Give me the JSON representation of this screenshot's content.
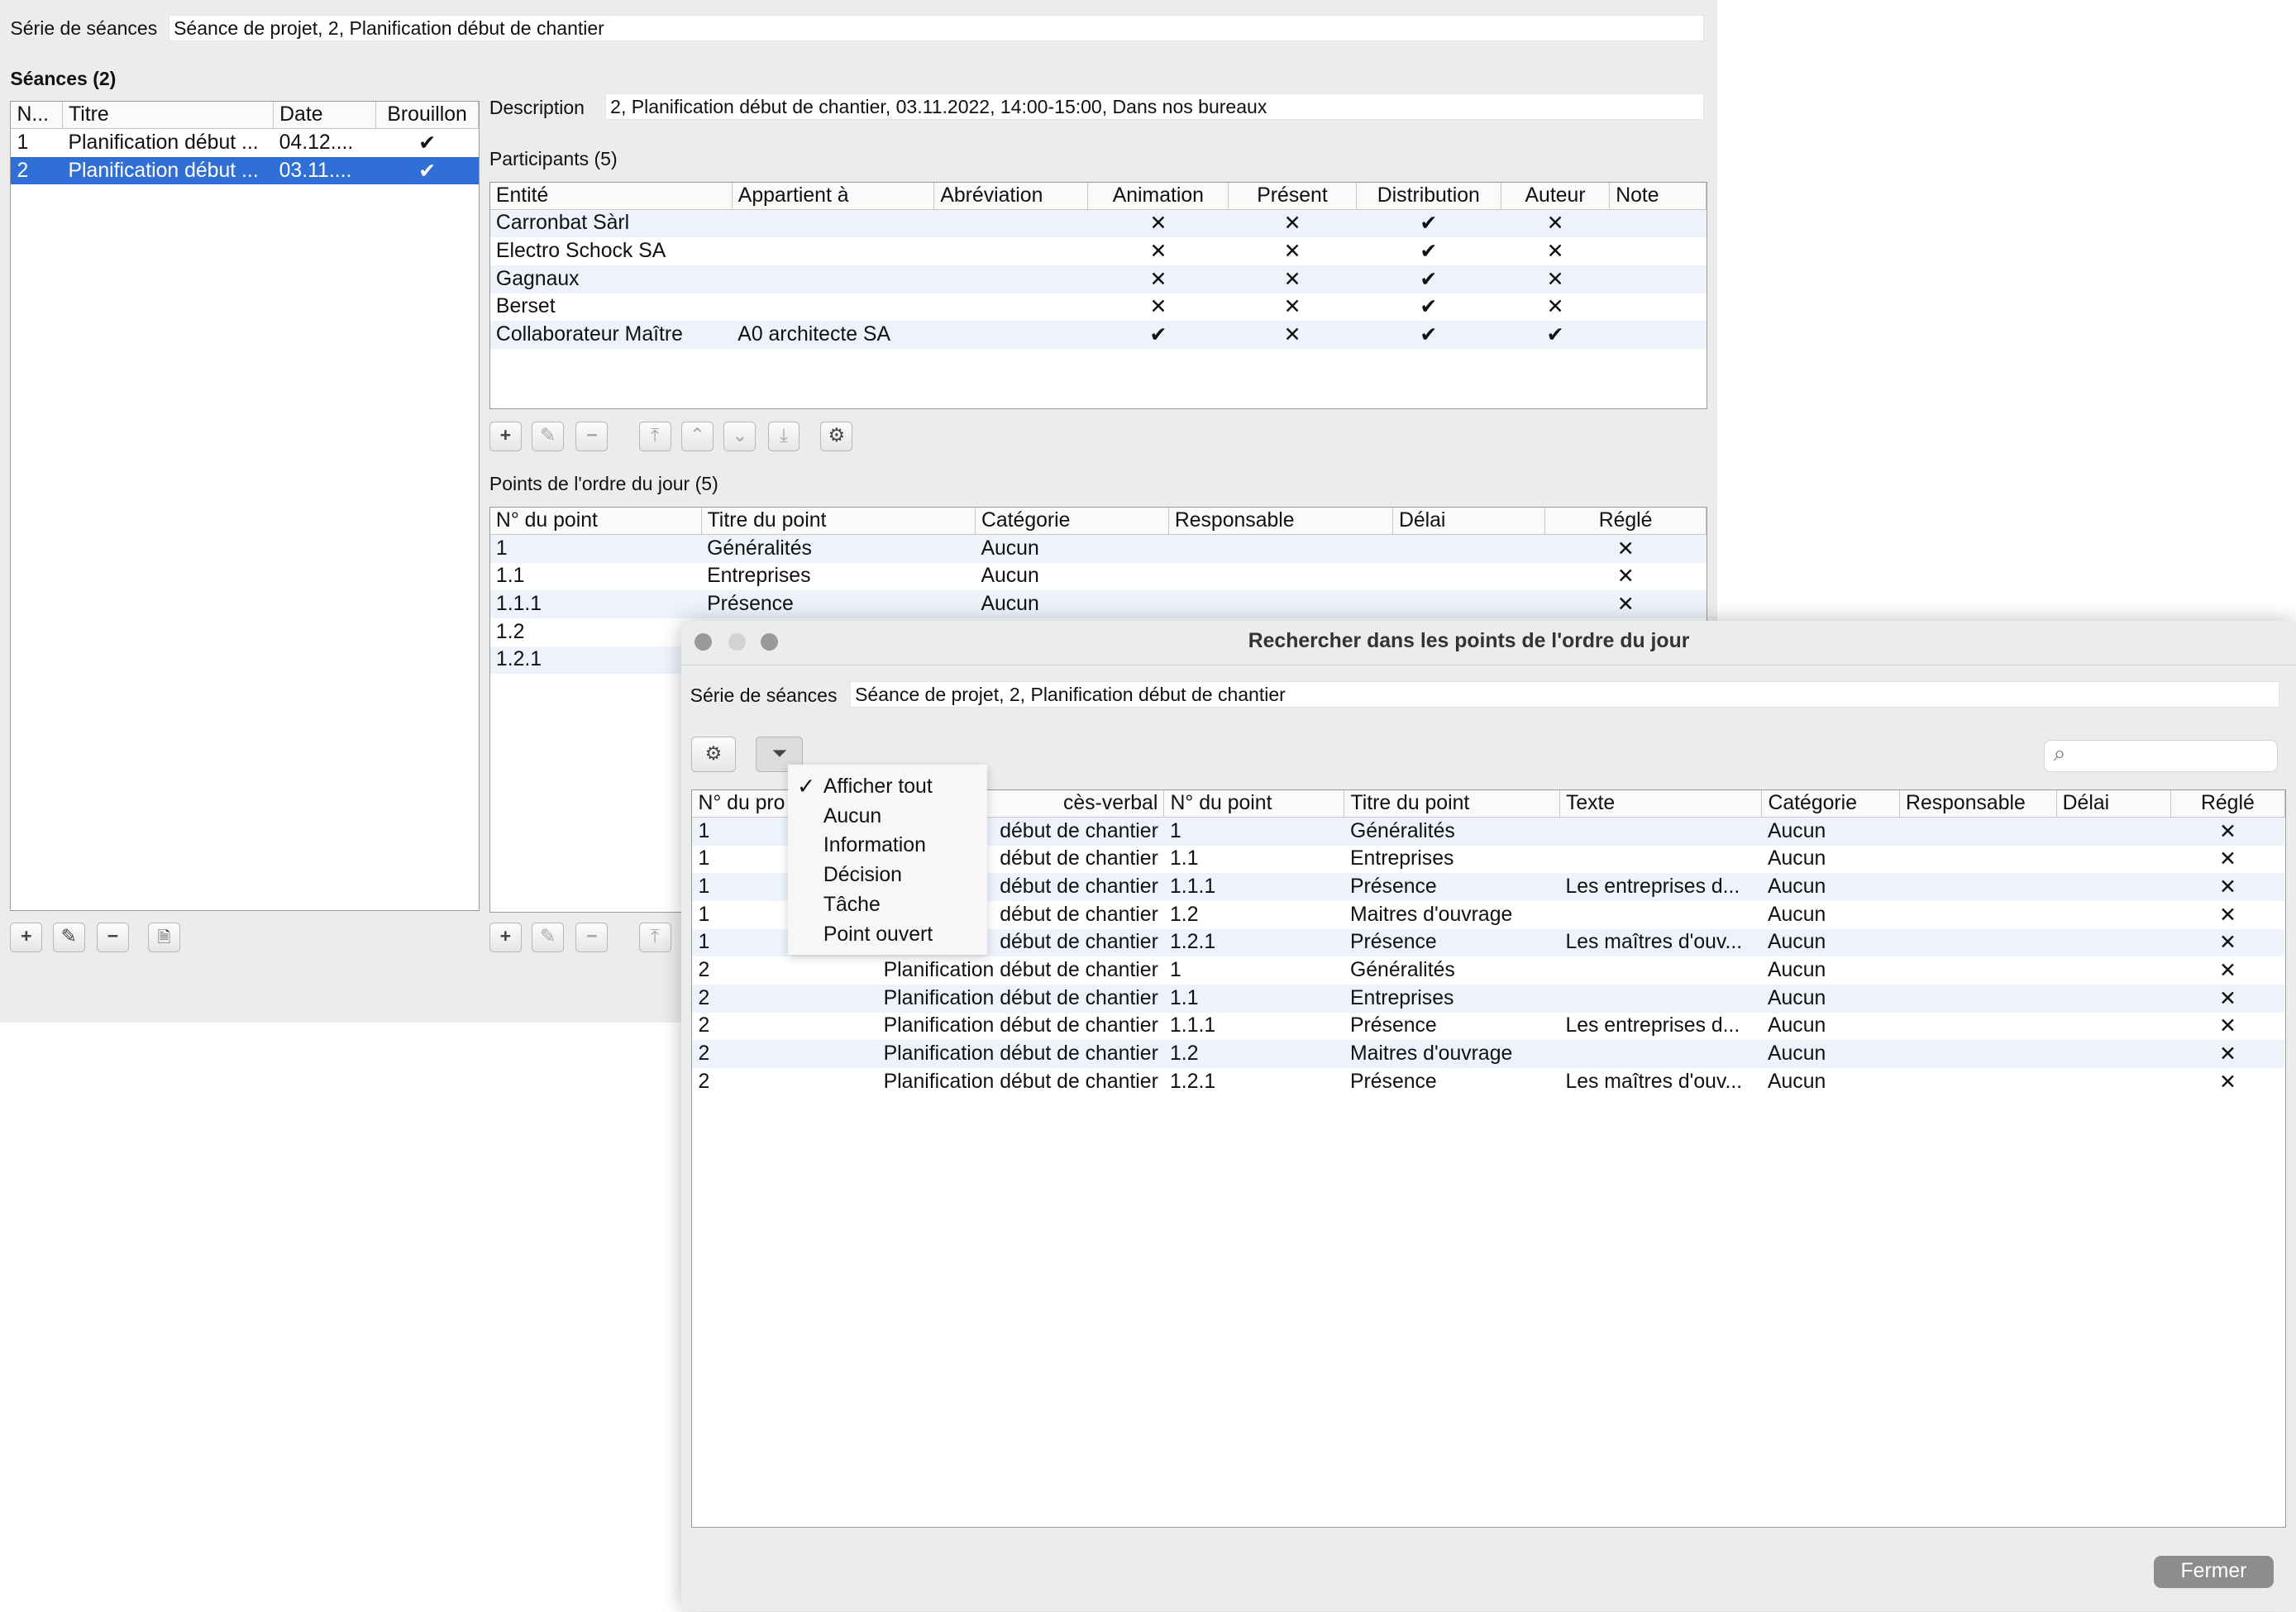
{
  "main": {
    "serie_label": "Série de séances",
    "serie_value": "Séance de projet, 2, Planification début de chantier",
    "seances_title": "Séances (2)",
    "seances_columns": [
      "N...",
      "Titre",
      "Date",
      "Brouillon"
    ],
    "seances_rows": [
      {
        "n": "1",
        "titre": "Planification début ...",
        "date": "04.12....",
        "brouillon": "✔"
      },
      {
        "n": "2",
        "titre": "Planification début ...",
        "date": "03.11....",
        "brouillon": "✔"
      }
    ],
    "description_label": "Description",
    "description_value": "2, Planification début de chantier, 03.11.2022, 14:00-15:00, Dans nos bureaux",
    "participants_title": "Participants (5)",
    "participants_columns": [
      "Entité",
      "Appartient à",
      "Abréviation",
      "Animation",
      "Présent",
      "Distribution",
      "Auteur",
      "Note"
    ],
    "participants_rows": [
      {
        "entite": "Carronbat Sàrl",
        "appartient": "",
        "abrev": "",
        "animation": "✕",
        "present": "✕",
        "distribution": "✔",
        "auteur": "✕",
        "note": ""
      },
      {
        "entite": "Electro Schock SA",
        "appartient": "",
        "abrev": "",
        "animation": "✕",
        "present": "✕",
        "distribution": "✔",
        "auteur": "✕",
        "note": ""
      },
      {
        "entite": "Gagnaux",
        "appartient": "",
        "abrev": "",
        "animation": "✕",
        "present": "✕",
        "distribution": "✔",
        "auteur": "✕",
        "note": ""
      },
      {
        "entite": "Berset",
        "appartient": "",
        "abrev": "",
        "animation": "✕",
        "present": "✕",
        "distribution": "✔",
        "auteur": "✕",
        "note": ""
      },
      {
        "entite": "Collaborateur Maître",
        "appartient": "A0 architecte SA",
        "abrev": "",
        "animation": "✔",
        "present": "✕",
        "distribution": "✔",
        "auteur": "✔",
        "note": ""
      }
    ],
    "points_title": "Points de l'ordre du jour (5)",
    "points_columns": [
      "N° du point",
      "Titre du point",
      "Catégorie",
      "Responsable",
      "Délai",
      "Réglé"
    ],
    "points_rows": [
      {
        "num": "1",
        "titre": "Généralités",
        "cat": "Aucun",
        "resp": "",
        "delai": "",
        "regle": "✕"
      },
      {
        "num": "1.1",
        "titre": "Entreprises",
        "cat": "Aucun",
        "resp": "",
        "delai": "",
        "regle": "✕"
      },
      {
        "num": "1.1.1",
        "titre": "Présence",
        "cat": "Aucun",
        "resp": "",
        "delai": "",
        "regle": "✕"
      },
      {
        "num": "1.2",
        "titre": "",
        "cat": "",
        "resp": "",
        "delai": "",
        "regle": ""
      },
      {
        "num": "1.2.1",
        "titre": "",
        "cat": "",
        "resp": "",
        "delai": "",
        "regle": ""
      }
    ]
  },
  "dialog": {
    "title": "Rechercher dans les points de l'ordre du jour",
    "serie_label": "Série de séances",
    "serie_value": "Séance de projet, 2, Planification début de chantier",
    "search_placeholder": "",
    "columns": [
      "N° du pro",
      "cès-verbal",
      "N° du point",
      "Titre du point",
      "Texte",
      "Catégorie",
      "Responsable",
      "Délai",
      "Réglé"
    ],
    "rows": [
      {
        "pv": "1",
        "titre_pv": "début de chantier",
        "num": "1",
        "titre": "Généralités",
        "texte": "",
        "cat": "Aucun",
        "resp": "",
        "delai": "",
        "regle": "✕"
      },
      {
        "pv": "1",
        "titre_pv": "début de chantier",
        "num": "1.1",
        "titre": "Entreprises",
        "texte": "",
        "cat": "Aucun",
        "resp": "",
        "delai": "",
        "regle": "✕"
      },
      {
        "pv": "1",
        "titre_pv": "début de chantier",
        "num": "1.1.1",
        "titre": "Présence",
        "texte": "Les entreprises d...",
        "cat": "Aucun",
        "resp": "",
        "delai": "",
        "regle": "✕"
      },
      {
        "pv": "1",
        "titre_pv": "début de chantier",
        "num": "1.2",
        "titre": "Maitres d'ouvrage",
        "texte": "",
        "cat": "Aucun",
        "resp": "",
        "delai": "",
        "regle": "✕"
      },
      {
        "pv": "1",
        "titre_pv": "début de chantier",
        "num": "1.2.1",
        "titre": "Présence",
        "texte": "Les maîtres d'ouv...",
        "cat": "Aucun",
        "resp": "",
        "delai": "",
        "regle": "✕"
      },
      {
        "pv": "2",
        "titre_pv": "Planification début de chantier",
        "num": "1",
        "titre": "Généralités",
        "texte": "",
        "cat": "Aucun",
        "resp": "",
        "delai": "",
        "regle": "✕"
      },
      {
        "pv": "2",
        "titre_pv": "Planification début de chantier",
        "num": "1.1",
        "titre": "Entreprises",
        "texte": "",
        "cat": "Aucun",
        "resp": "",
        "delai": "",
        "regle": "✕"
      },
      {
        "pv": "2",
        "titre_pv": "Planification début de chantier",
        "num": "1.1.1",
        "titre": "Présence",
        "texte": "Les entreprises d...",
        "cat": "Aucun",
        "resp": "",
        "delai": "",
        "regle": "✕"
      },
      {
        "pv": "2",
        "titre_pv": "Planification début de chantier",
        "num": "1.2",
        "titre": "Maitres d'ouvrage",
        "texte": "",
        "cat": "Aucun",
        "resp": "",
        "delai": "",
        "regle": "✕"
      },
      {
        "pv": "2",
        "titre_pv": "Planification début de chantier",
        "num": "1.2.1",
        "titre": "Présence",
        "texte": "Les maîtres d'ouv...",
        "cat": "Aucun",
        "resp": "",
        "delai": "",
        "regle": "✕"
      }
    ],
    "filter_menu": {
      "checked_mark": "✓",
      "items": [
        "Afficher tout",
        "Aucun",
        "Information",
        "Décision",
        "Tâche",
        "Point ouvert"
      ]
    },
    "close_label": "Fermer"
  },
  "icons": {
    "plus": "+",
    "pencil": "✎",
    "minus": "−",
    "top": "⤒",
    "up": "⌃",
    "down": "⌄",
    "bottom": "⤓",
    "gear": "⚙",
    "filter": "⏷",
    "doc": "🗎",
    "search": "⌕"
  },
  "colors": {
    "selection": "#2f6fd6",
    "alt_row": "#eef3fb",
    "window_bg": "#ececec"
  }
}
